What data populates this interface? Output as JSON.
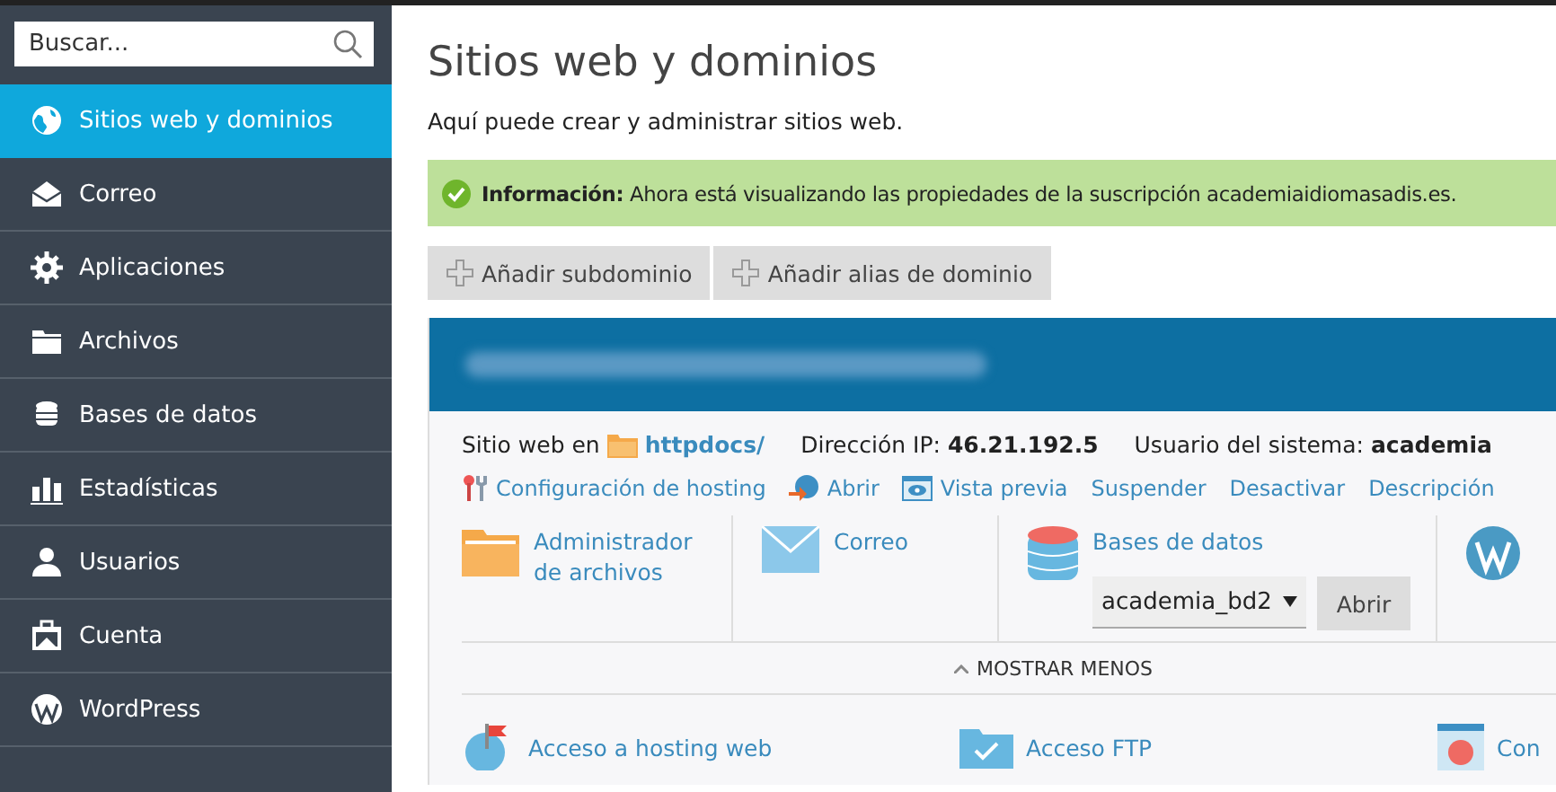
{
  "sidebar": {
    "search": {
      "placeholder": "Buscar..."
    },
    "items": [
      {
        "label": "Sitios web y dominios",
        "selected": true
      },
      {
        "label": "Correo",
        "selected": false
      },
      {
        "label": "Aplicaciones",
        "selected": false
      },
      {
        "label": "Archivos",
        "selected": false
      },
      {
        "label": "Bases de datos",
        "selected": false
      },
      {
        "label": "Estadísticas",
        "selected": false
      },
      {
        "label": "Usuarios",
        "selected": false
      },
      {
        "label": "Cuenta",
        "selected": false
      },
      {
        "label": "WordPress",
        "selected": false
      }
    ]
  },
  "page": {
    "title": "Sitios web y dominios",
    "subtitle": "Aquí puede crear y administrar sitios web.",
    "message": {
      "label": "Información:",
      "text": "Ahora está visualizando las propiedades de la suscripción academiaidiomasadis.es."
    },
    "buttons": [
      "Añadir subdominio",
      "Añadir alias de dominio"
    ]
  },
  "domain": {
    "site_label": "Sitio web en",
    "site_path": "httpdocs/",
    "ip_label": "Dirección IP:",
    "ip": "46.21.192.5",
    "user_label": "Usuario del sistema:",
    "user": "academia",
    "actions": [
      "Configuración de hosting",
      "Abrir",
      "Vista previa",
      "Suspender",
      "Desactivar",
      "Descripción"
    ],
    "tools": [
      {
        "kind": "files",
        "label": "Administrador de archivos"
      },
      {
        "kind": "mail",
        "label": "Correo"
      },
      {
        "kind": "db",
        "label": "Bases de datos",
        "select": "academia_bd2",
        "button": "Abrir"
      },
      {
        "kind": "wp"
      }
    ],
    "toggle": "MOSTRAR MENOS",
    "more": [
      {
        "label": "Acceso a hosting web"
      },
      {
        "label": "Acceso FTP"
      },
      {
        "label": "Con"
      }
    ]
  }
}
